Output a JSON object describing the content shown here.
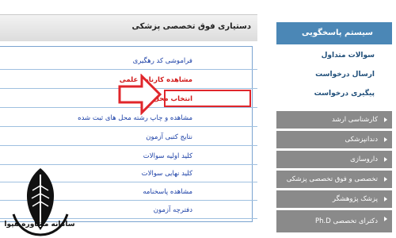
{
  "sidebar": {
    "header": "سیستم پاسخگویی",
    "links": [
      "سوالات متداول",
      "ارسال درخواست",
      "پیگیری درخواست"
    ],
    "menu": [
      "کارشناسی ارشد",
      "دندانپزشکی",
      "داروسازی",
      "تخصصی و فوق تخصصی پزشکی",
      "پزشک پژوهشگر",
      "دکترای تخصصی Ph.D"
    ]
  },
  "panel": {
    "title": "دستیاری فوق تخصصی پزشکی",
    "items": [
      "فراموشی کد رهگیری",
      "مشاهده کارنامه علمی",
      "انتخاب محل و ویرایش",
      "مشاهده و چاپ رشته محل های ثبت شده",
      "نتایج کتبی آزمون",
      "کلید اولیه سوالات",
      "کلید نهایی سوالات",
      "مشاهده پاسخنامه",
      "دفترچه آزمون"
    ]
  },
  "branding": {
    "logo_text": "سامانه مشاوره هپوا"
  },
  "colors": {
    "accent": "#4b87b6",
    "link": "#1a3fa6",
    "highlight": "#e0262b",
    "menu_grey": "#8a8a8a"
  }
}
